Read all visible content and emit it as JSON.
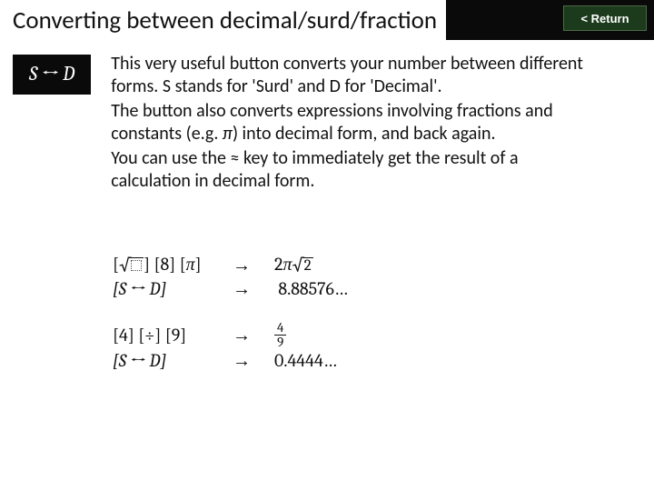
{
  "title": "Converting between decimal/surd/fraction",
  "return_label": "< Return",
  "key_label": "S ↔ D",
  "body": {
    "p1a": "This very useful button converts your number between different forms. S stands for 'Surd' and D for 'Decimal'.",
    "p2a": "The button also converts expressions involving fractions and constants (e.g. ",
    "p2_pi": "π",
    "p2b": ") into decimal form, and back again.",
    "p3a": "You can use the ",
    "p3_approx": "≈",
    "p3b": " key to immediately get the result of a calculation in decimal form."
  },
  "examples": {
    "row1": {
      "keys_open": "[",
      "k1": "√",
      "k1_close": "] [8] [",
      "k_pi": "π",
      "k_end": "]",
      "arrow": "→",
      "result_pre": "2",
      "result_pi": "π",
      "result_sqrt": "2"
    },
    "row2": {
      "keys": "[S ↔ D]",
      "arrow": "→",
      "result": "8.88576…"
    },
    "row3": {
      "keys": "[4] [÷] [9]",
      "arrow": "→",
      "num": "4",
      "den": "9"
    },
    "row4": {
      "keys": "[S ↔ D]",
      "arrow": "→",
      "result": "0.4444…"
    }
  }
}
